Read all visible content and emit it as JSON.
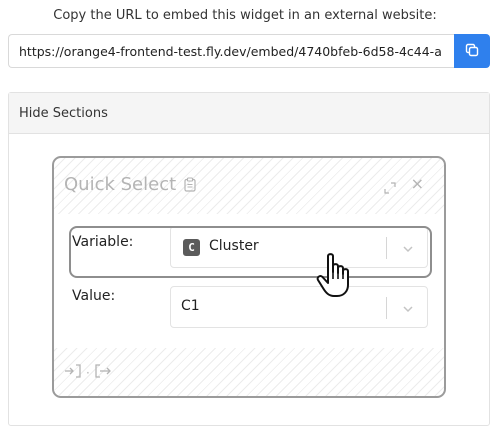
{
  "embed": {
    "label": "Copy the URL to embed this widget in an external website:",
    "url": "https://orange4-frontend-test.fly.dev/embed/4740bfeb-6d58-4c44-a",
    "copy_icon": "copy-icon"
  },
  "sections": {
    "toggle_label": "Hide Sections"
  },
  "widget": {
    "title": "Quick Select",
    "title_icon": "clipboard-icon",
    "expand_icon": "expand-icon",
    "close_glyph": "×",
    "variable_label": "Variable:",
    "variable_badge": "C",
    "variable_value": "Cluster",
    "value_label": "Value:",
    "value_value": "C1",
    "footer_icons": [
      "import-icon",
      "export-icon"
    ],
    "footer_separator": "·"
  },
  "colors": {
    "accent": "#2f80ed",
    "border": "#9b9b9b",
    "badge": "#5b5b5b"
  }
}
